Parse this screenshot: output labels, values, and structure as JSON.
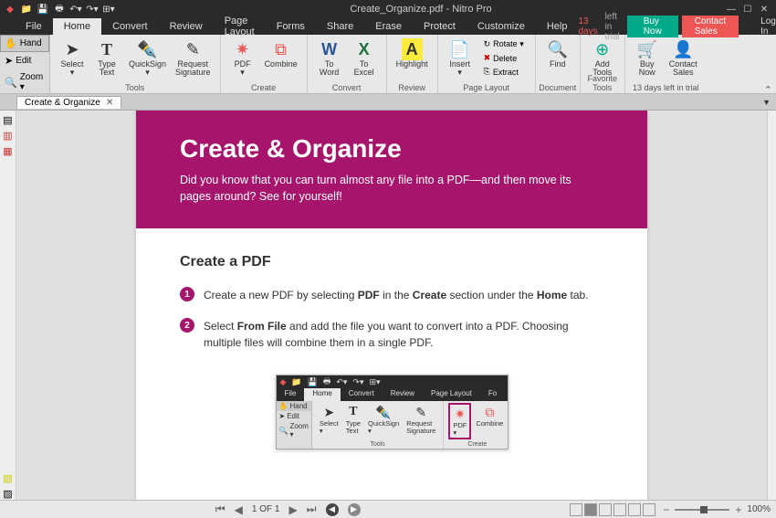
{
  "titlebar": {
    "title": "Create_Organize.pdf - Nitro Pro"
  },
  "menu": {
    "tabs": [
      "File",
      "Home",
      "Convert",
      "Review",
      "Page Layout",
      "Forms",
      "Share",
      "Erase",
      "Protect",
      "Customize",
      "Help"
    ],
    "active": "Home",
    "trial_days": "13 days",
    "trial_suffix": "left in trial",
    "buy": "Buy Now",
    "contact": "Contact Sales",
    "login": "Log In"
  },
  "leftpanel": {
    "hand": "Hand",
    "edit": "Edit",
    "zoom": "Zoom ▾"
  },
  "ribbon": {
    "tools": {
      "label": "Tools",
      "select": "Select\n▾",
      "type": "Type\nText",
      "quicksign": "QuickSign\n▾",
      "reqsig": "Request\nSignature"
    },
    "create": {
      "label": "Create",
      "pdf": "PDF\n▾",
      "combine": "Combine"
    },
    "convert": {
      "label": "Convert",
      "word": "To\nWord",
      "excel": "To\nExcel"
    },
    "review": {
      "label": "Review",
      "highlight": "Highlight"
    },
    "pagelayout": {
      "label": "Page Layout",
      "insert": "Insert\n▾",
      "rotate": "Rotate ▾",
      "delete": "Delete",
      "extract": "Extract"
    },
    "document": {
      "label": "Document",
      "find": "Find"
    },
    "favorite": {
      "label": "Favorite Tools",
      "addtools": "Add\nTools"
    },
    "trialend": {
      "label": "13 days left in trial",
      "buynow": "Buy\nNow",
      "csales": "Contact\nSales"
    }
  },
  "doctab": {
    "title": "Create & Organize"
  },
  "doc": {
    "banner_title": "Create & Organize",
    "banner_text": "Did you know that you can turn almost any file into a PDF—and then move its pages around? See for yourself!",
    "section": "Create a PDF",
    "step1_a": "Create a new PDF by selecting ",
    "step1_b": "PDF",
    "step1_c": " in the ",
    "step1_d": "Create",
    "step1_e": " section under the ",
    "step1_f": "Home",
    "step1_g": " tab.",
    "step2_a": "Select ",
    "step2_b": "From File",
    "step2_c": " and add the file you want to convert into a PDF. Choosing multiple files will combine them in a single PDF."
  },
  "mini": {
    "tabs": [
      "File",
      "Home",
      "Convert",
      "Review",
      "Page Layout",
      "Fo"
    ],
    "lp": {
      "hand": "Hand",
      "edit": "Edit",
      "zoom": "Zoom ▾"
    },
    "tools": {
      "label": "Tools",
      "select": "Select\n▾",
      "type": "Type\nText",
      "quicksign": "QuickSign\n▾",
      "reqsig": "Request\nSignature"
    },
    "create": {
      "label": "Create",
      "pdf": "PDF\n▾",
      "combine": "Combine"
    }
  },
  "status": {
    "page": "1 OF 1",
    "zoom": "100%"
  }
}
